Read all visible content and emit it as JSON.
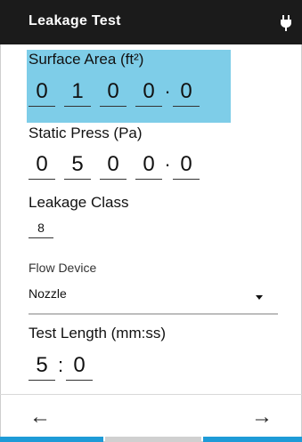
{
  "header": {
    "title": "Leakage Test",
    "plug_icon": "plug-icon"
  },
  "colors": {
    "header_bg": "#1b1b1b",
    "highlight": "#7ecde8",
    "accent": "#1e9bd7",
    "inactive_bar": "#d0d0d0"
  },
  "surface_area": {
    "label": "Surface Area (ft²)",
    "digits": [
      "0",
      "1",
      "0",
      "0",
      "0"
    ],
    "decimal": "·"
  },
  "static_press": {
    "label": "Static Press (Pa)",
    "digits": [
      "0",
      "5",
      "0",
      "0",
      "0"
    ],
    "decimal": "·"
  },
  "leakage_class": {
    "label": "Leakage Class",
    "value": "8"
  },
  "flow_device": {
    "label": "Flow Device",
    "value": "Nozzle"
  },
  "test_length": {
    "label": "Test Length (mm:ss)",
    "digits": [
      "5",
      "0"
    ],
    "separator": ":"
  },
  "nav": {
    "back": "←",
    "forward": "→"
  }
}
